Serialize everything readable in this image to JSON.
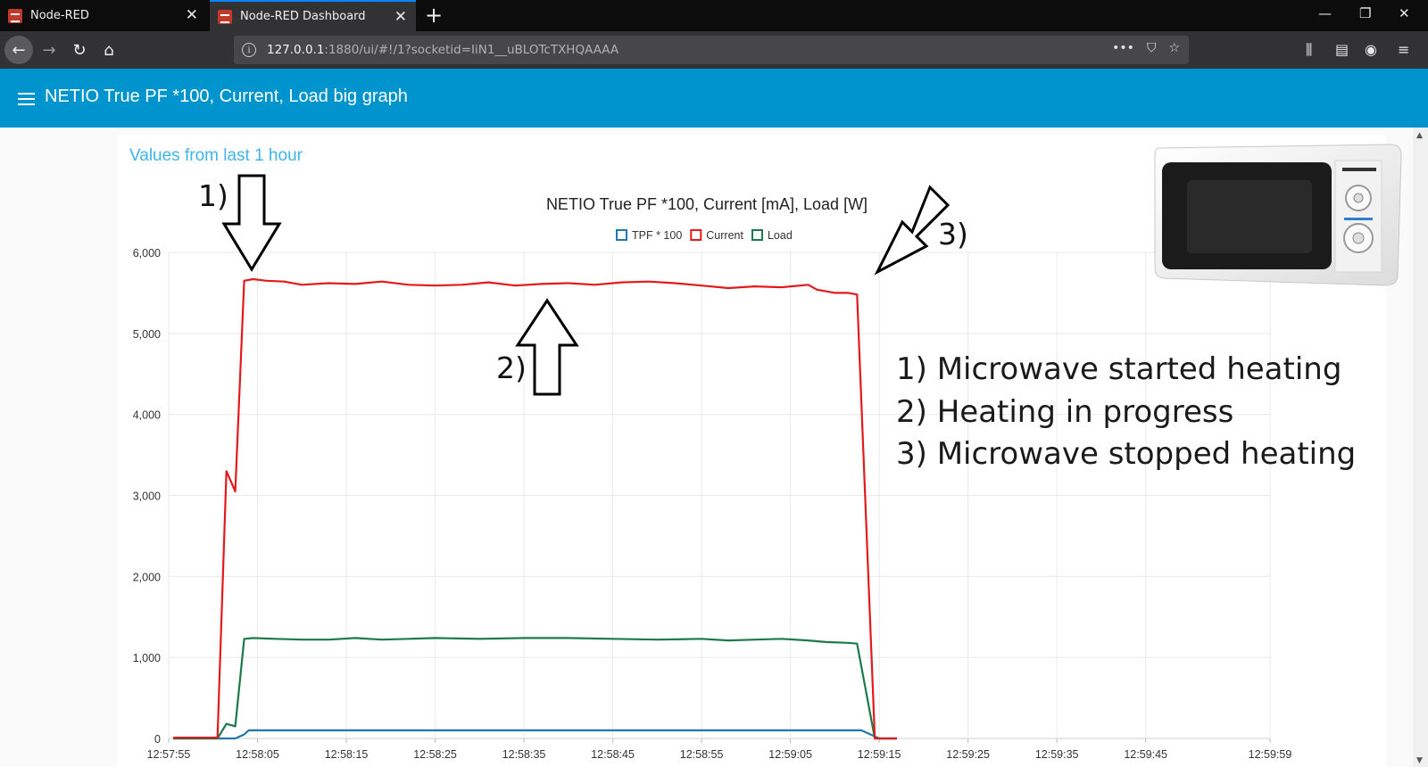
{
  "browser": {
    "tabs": [
      {
        "label": "Node-RED",
        "active": false
      },
      {
        "label": "Node-RED Dashboard",
        "active": true
      }
    ],
    "url_host": "127.0.0.1",
    "url_rest": ":1880/ui/#!/1?socketid=IiN1__uBLOTcTXHQAAAA"
  },
  "dashboard": {
    "title": "NETIO True PF *100, Current, Load big graph",
    "card_title": "Values from last 1 hour"
  },
  "annotations": {
    "note1": "1) Microwave started heating",
    "note2": "2) Heating in progress",
    "note3": "3) Microwave stopped heating",
    "marker1": "1)",
    "marker2": "2)",
    "marker3": "3)"
  },
  "chart_data": {
    "type": "line",
    "title": "NETIO True PF *100, Current [mA], Load [W]",
    "legend_position": "top",
    "grid": true,
    "ylim": [
      0,
      6000
    ],
    "yticks": [
      "0",
      "1,000",
      "2,000",
      "3,000",
      "4,000",
      "5,000",
      "6,000"
    ],
    "x_range_seconds": [
      0,
      124
    ],
    "xticks": [
      {
        "s": 0,
        "label": "12:57:55"
      },
      {
        "s": 10,
        "label": "12:58:05"
      },
      {
        "s": 20,
        "label": "12:58:15"
      },
      {
        "s": 30,
        "label": "12:58:25"
      },
      {
        "s": 40,
        "label": "12:58:35"
      },
      {
        "s": 50,
        "label": "12:58:45"
      },
      {
        "s": 60,
        "label": "12:58:55"
      },
      {
        "s": 70,
        "label": "12:59:05"
      },
      {
        "s": 80,
        "label": "12:59:15"
      },
      {
        "s": 90,
        "label": "12:59:25"
      },
      {
        "s": 100,
        "label": "12:59:35"
      },
      {
        "s": 110,
        "label": "12:59:45"
      },
      {
        "s": 124,
        "label": "12:59:59"
      }
    ],
    "series": [
      {
        "name": "TPF * 100",
        "color": "#1f77b4",
        "points": [
          [
            0.5,
            0
          ],
          [
            5.5,
            0
          ],
          [
            7.5,
            0
          ],
          [
            8.5,
            50
          ],
          [
            9,
            100
          ],
          [
            20,
            100
          ],
          [
            40,
            100
          ],
          [
            60,
            100
          ],
          [
            78,
            100
          ],
          [
            80,
            0
          ],
          [
            82,
            0
          ]
        ]
      },
      {
        "name": "Current",
        "color": "#e31a1c",
        "points": [
          [
            0.5,
            10
          ],
          [
            5.5,
            10
          ],
          [
            6.5,
            3300
          ],
          [
            7.5,
            3050
          ],
          [
            8.5,
            5650
          ],
          [
            9.5,
            5670
          ],
          [
            11,
            5650
          ],
          [
            13,
            5640
          ],
          [
            15,
            5600
          ],
          [
            18,
            5620
          ],
          [
            21,
            5610
          ],
          [
            24,
            5640
          ],
          [
            27,
            5600
          ],
          [
            30,
            5590
          ],
          [
            33,
            5600
          ],
          [
            36,
            5630
          ],
          [
            39,
            5590
          ],
          [
            42,
            5610
          ],
          [
            45,
            5620
          ],
          [
            48,
            5600
          ],
          [
            51,
            5630
          ],
          [
            54,
            5640
          ],
          [
            57,
            5620
          ],
          [
            60,
            5590
          ],
          [
            63,
            5560
          ],
          [
            66,
            5580
          ],
          [
            69,
            5570
          ],
          [
            72,
            5600
          ],
          [
            73,
            5540
          ],
          [
            75,
            5500
          ],
          [
            76.5,
            5500
          ],
          [
            77.5,
            5480
          ],
          [
            79.5,
            0
          ],
          [
            82,
            0
          ]
        ]
      },
      {
        "name": "Load",
        "color": "#1b7a4a",
        "points": [
          [
            0.5,
            0
          ],
          [
            5.5,
            0
          ],
          [
            6.5,
            180
          ],
          [
            7.5,
            150
          ],
          [
            8.5,
            1230
          ],
          [
            9.5,
            1240
          ],
          [
            12,
            1230
          ],
          [
            15,
            1220
          ],
          [
            18,
            1220
          ],
          [
            21,
            1240
          ],
          [
            24,
            1220
          ],
          [
            27,
            1230
          ],
          [
            30,
            1240
          ],
          [
            35,
            1230
          ],
          [
            40,
            1240
          ],
          [
            45,
            1240
          ],
          [
            50,
            1230
          ],
          [
            55,
            1220
          ],
          [
            60,
            1230
          ],
          [
            63,
            1210
          ],
          [
            66,
            1220
          ],
          [
            69,
            1230
          ],
          [
            72,
            1210
          ],
          [
            74,
            1190
          ],
          [
            76.5,
            1180
          ],
          [
            77.5,
            1170
          ],
          [
            79.5,
            0
          ],
          [
            82,
            0
          ]
        ]
      }
    ]
  }
}
